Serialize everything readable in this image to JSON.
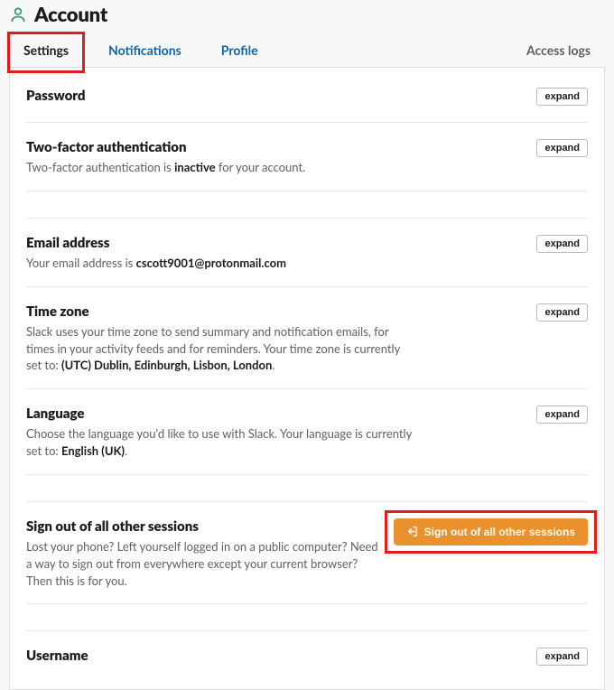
{
  "header": {
    "title": "Account"
  },
  "tabs": {
    "settings": "Settings",
    "notifications": "Notifications",
    "profile": "Profile",
    "access_logs": "Access logs"
  },
  "buttons": {
    "expand": "expand",
    "signout_all": "Sign out of all other sessions"
  },
  "sections": {
    "password": {
      "title": "Password"
    },
    "twofa": {
      "title": "Two-factor authentication",
      "desc_pre": "Two-factor authentication is ",
      "desc_bold": "inactive",
      "desc_post": " for your account."
    },
    "email": {
      "title": "Email address",
      "desc_pre": "Your email address is ",
      "desc_bold": "cscott9001@protonmail.com",
      "desc_post": ""
    },
    "timezone": {
      "title": "Time zone",
      "desc_pre": "Slack uses your time zone to send summary and notification emails, for times in your activity feeds and for reminders. Your time zone is currently set to: ",
      "desc_bold": "(UTC) Dublin, Edinburgh, Lisbon, London",
      "desc_post": "."
    },
    "language": {
      "title": "Language",
      "desc_pre": "Choose the language you'd like to use with Slack. Your language is currently set to: ",
      "desc_bold": "English (UK)",
      "desc_post": "."
    },
    "signout": {
      "title": "Sign out of all other sessions",
      "desc": "Lost your phone? Left yourself logged in on a public computer? Need a way to sign out from everywhere except your current browser? Then this is for you."
    },
    "username": {
      "title": "Username"
    }
  }
}
